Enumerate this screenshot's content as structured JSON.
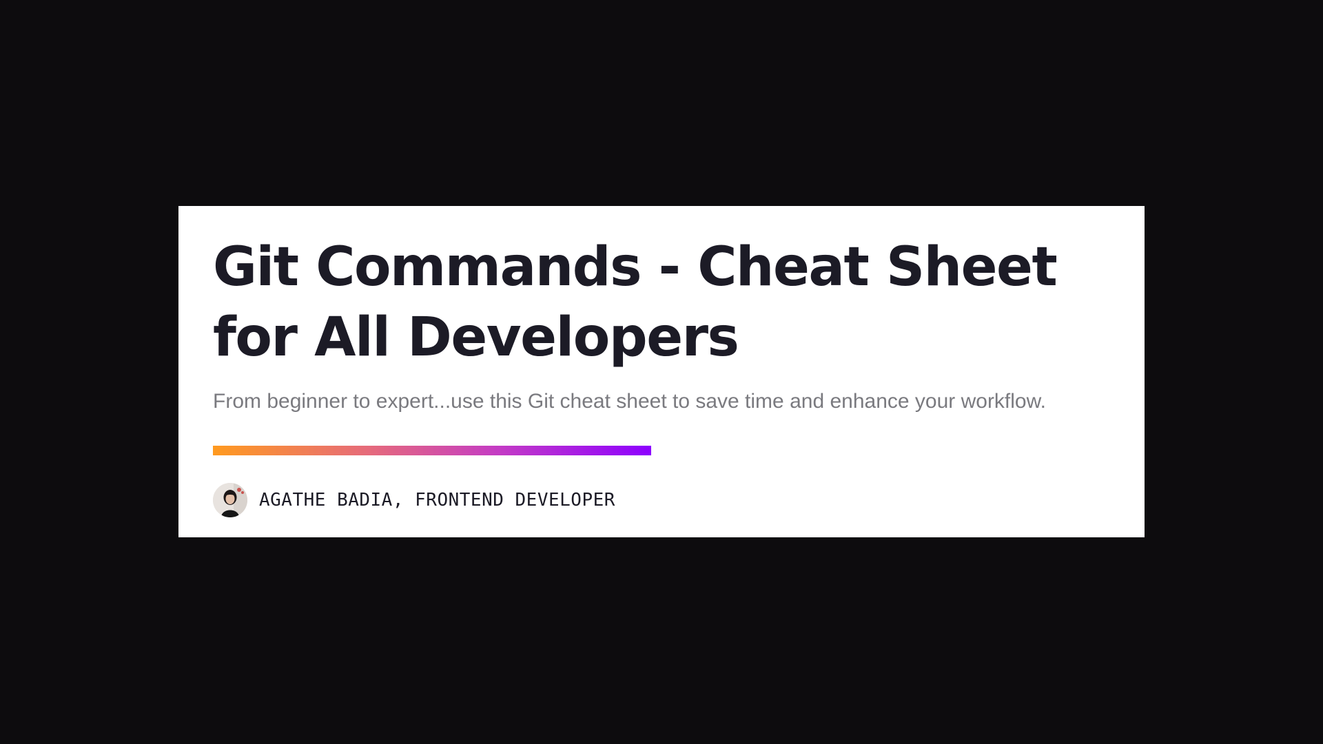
{
  "article": {
    "title": "Git Commands - Cheat Sheet for All Developers",
    "subtitle": "From beginner to expert...use this Git cheat sheet to save time and enhance your workflow.",
    "author": "AGATHE BADIA, FRONTEND DEVELOPER",
    "avatar_icon": "author-avatar-photo"
  },
  "colors": {
    "page_background": "#0d0c0e",
    "card_background": "#ffffff",
    "title_color": "#1c1b26",
    "subtitle_color": "#7a7a7f",
    "gradient_start": "#ff9a1f",
    "gradient_end": "#8d00ff"
  }
}
